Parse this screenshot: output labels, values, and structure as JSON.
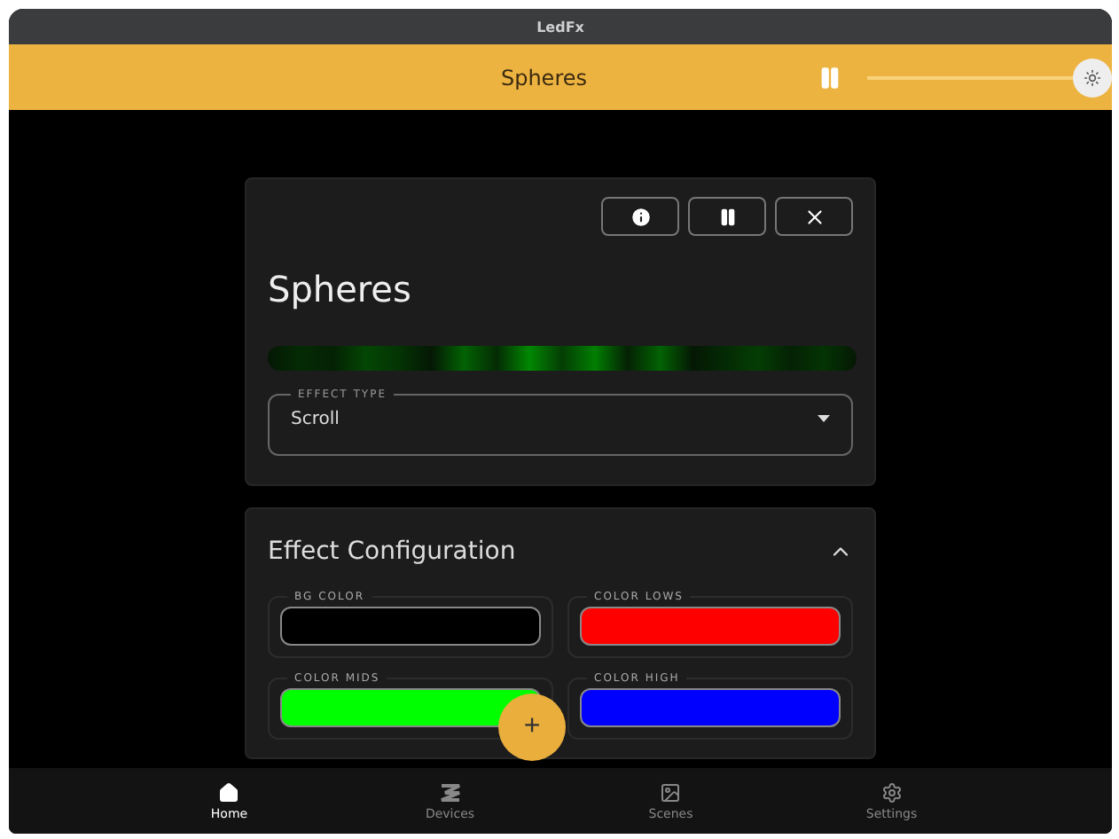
{
  "window": {
    "title": "LedFx"
  },
  "header": {
    "title": "Spheres",
    "paused": false,
    "brightness": {
      "level": 1
    }
  },
  "effect_card": {
    "title": "Spheres",
    "effect_type": {
      "label": "EFFECT TYPE",
      "value": "Scroll"
    }
  },
  "config_card": {
    "title": "Effect Configuration",
    "expanded": true,
    "colors": [
      {
        "label": "BG COLOR",
        "color": "#000000"
      },
      {
        "label": "COLOR LOWS",
        "color": "#ff0000"
      },
      {
        "label": "COLOR MIDS",
        "color": "#00ff00"
      },
      {
        "label": "COLOR HIGH",
        "color": "#0000ff"
      }
    ]
  },
  "fab": {
    "label": "+"
  },
  "nav": [
    {
      "label": "Home",
      "selected": true
    },
    {
      "label": "Devices",
      "selected": false
    },
    {
      "label": "Scenes",
      "selected": false
    },
    {
      "label": "Settings",
      "selected": false
    }
  ]
}
